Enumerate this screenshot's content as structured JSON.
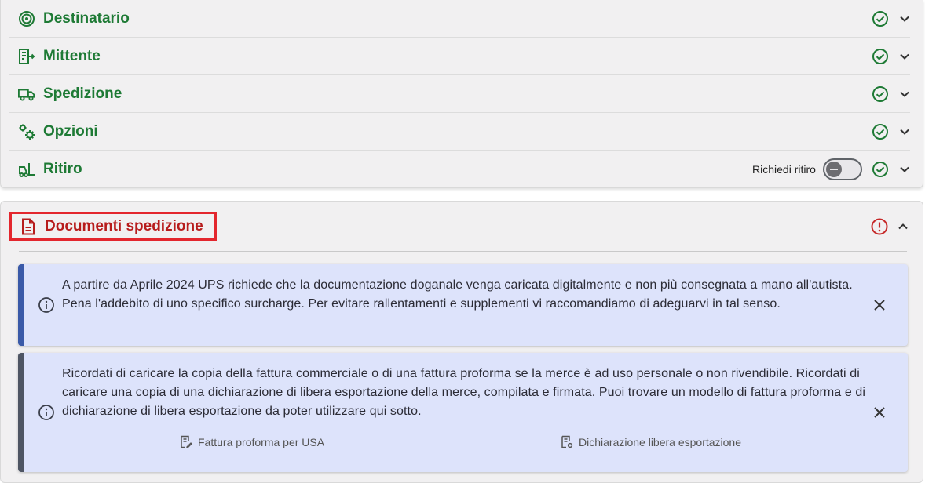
{
  "sections": [
    {
      "title": "Destinatario",
      "icon": "target-icon"
    },
    {
      "title": "Mittente",
      "icon": "building-arrow-icon"
    },
    {
      "title": "Spedizione",
      "icon": "truck-icon"
    },
    {
      "title": "Opzioni",
      "icon": "gears-icon"
    },
    {
      "title": "Ritiro",
      "icon": "forklift-icon"
    }
  ],
  "ritiro": {
    "toggle_label": "Richiedi ritiro",
    "toggle_on": false
  },
  "documents": {
    "title": "Documenti spedizione",
    "status": "error",
    "alerts": [
      {
        "text": "A partire da Aprile 2024 UPS richiede che la documentazione doganale venga caricata digitalmente e non più consegnata a mano all'autista. Pena l'addebito di uno specifico surcharge. Per evitare rallentamenti e supplementi vi raccomandiamo di adeguarvi in tal senso."
      },
      {
        "text": "Ricordati di caricare la copia della fattura commerciale o di una fattura proforma se la merce è ad uso personale o non rivendibile. Ricordati di caricare una copia di una dichiarazione di libera esportazione della merce, compilata e firmata. Puoi trovare un modello di fattura proforma e di dichiarazione di libera esportazione da poter utilizzare qui sotto.",
        "links": [
          "Fattura proforma per USA",
          "Dichiarazione libera esportazione"
        ]
      }
    ]
  },
  "colors": {
    "section_title": "#1e7a35",
    "error": "#b71c1c",
    "highlight_border": "#e3262d",
    "alert_bg": "#dde3fb",
    "alert1_bar": "#3a5aa8",
    "alert2_bar": "#4e5563"
  }
}
